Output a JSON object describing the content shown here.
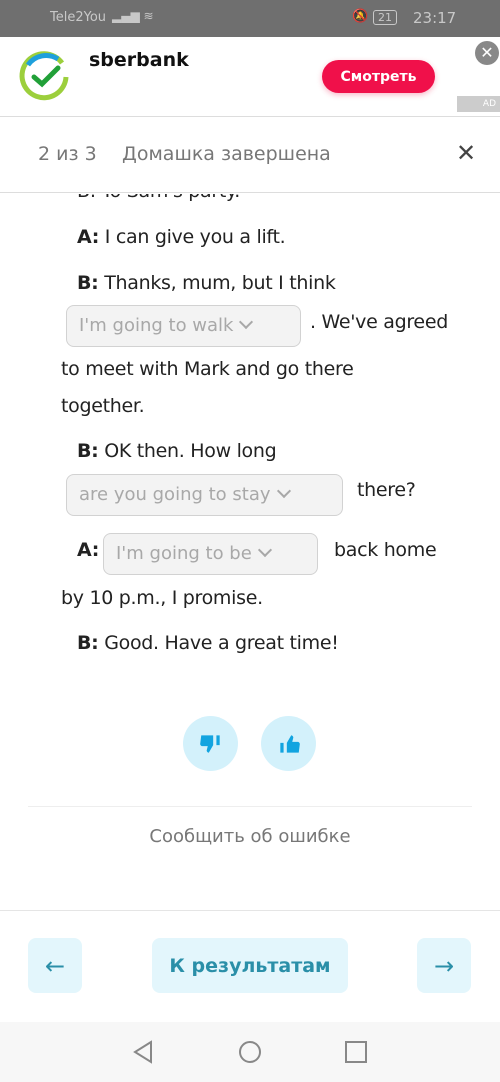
{
  "status_bar": {
    "carrier": "Tele2You",
    "battery": "21",
    "time": "23:17"
  },
  "ad": {
    "brand": "sberbank",
    "cta": "Смотреть",
    "badge": "AD",
    "brand_color": "#21a038",
    "cta_color": "#f0104a"
  },
  "header": {
    "progress": "2 из 3",
    "title": "Домашка завершена"
  },
  "dialogue": {
    "clipped_line": "B: To Sam's party.",
    "line1_speaker": "A:",
    "line1_text": " I can give you a lift.",
    "line2_speaker": "B:",
    "line2_text": " Thanks, mum, but I think",
    "dropdown1": "I'm going to walk",
    "line2_after": ". We've agreed",
    "line2_cont1": "to meet with Mark and go there",
    "line2_cont2": "together.",
    "line3_speaker": "B:",
    "line3_text": " OK then. How long",
    "dropdown2": "are you going to stay",
    "line3_after": "there?",
    "line4_speaker": "A:",
    "dropdown3": "I'm going to be",
    "line4_after": "back home",
    "line4_cont": "by 10 p.m., I promise.",
    "line5_speaker": "B:",
    "line5_text": " Good. Have a great time!"
  },
  "feedback": {
    "report_error": "Сообщить об ошибке"
  },
  "footer": {
    "prev": "←",
    "results": "К результатам",
    "next": "→"
  }
}
